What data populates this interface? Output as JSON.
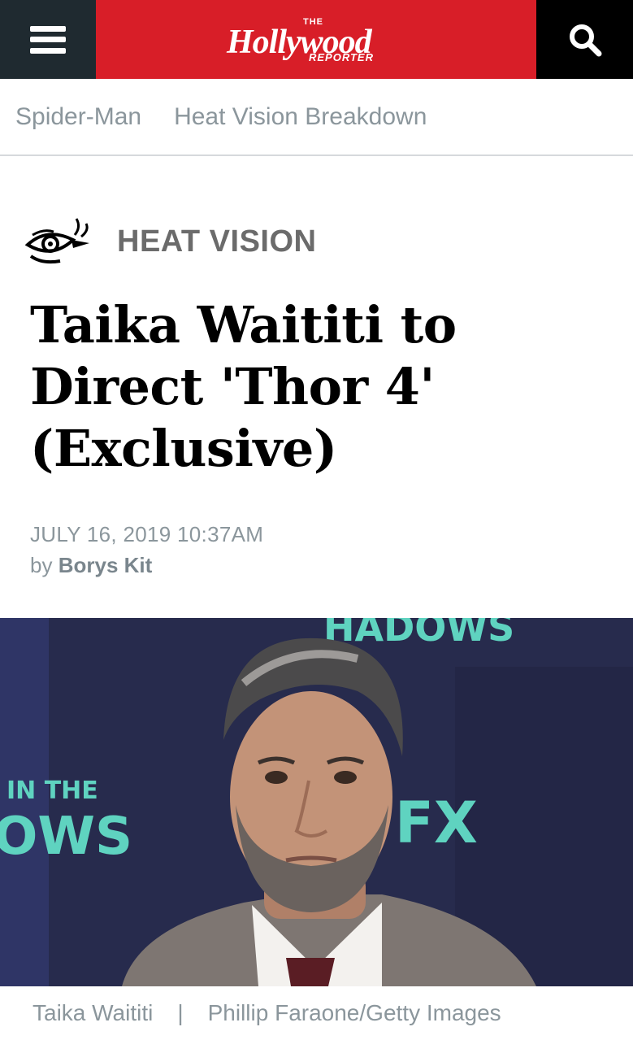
{
  "header": {
    "logo": {
      "the": "THE",
      "main": "Hollywood",
      "reporter": "REPORTER"
    },
    "brand_color": "#d81e28",
    "menu_icon": "hamburger-menu-icon",
    "search_icon": "search-icon"
  },
  "subnav": {
    "items": [
      {
        "label": "Spider-Man"
      },
      {
        "label": "Heat Vision Breakdown"
      }
    ]
  },
  "article": {
    "section": {
      "icon": "heat-vision-eye-icon",
      "label": "HEAT VISION"
    },
    "headline": "Taika Waititi to Direct 'Thor 4' (Exclusive)",
    "date": "JULY 16, 2019 10:37AM",
    "byline_prefix": "by",
    "author": "Borys Kit",
    "photo": {
      "backdrop_text_top": "HADOWS",
      "backdrop_text_left_1": "IN THE",
      "backdrop_text_left_2": "OWS",
      "backdrop_logo": "FX"
    },
    "caption": {
      "subject": "Taika Waititi",
      "separator": "|",
      "credit": "Phillip Faraone/Getty Images"
    }
  }
}
